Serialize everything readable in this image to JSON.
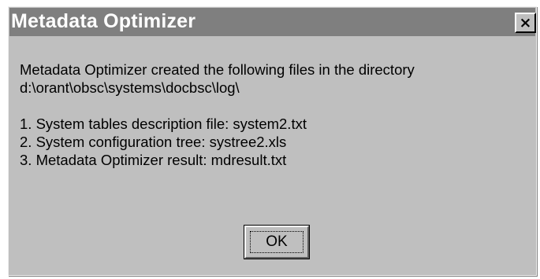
{
  "window": {
    "title": "Metadata Optimizer",
    "close_icon": "close-icon",
    "close_glyph": "×"
  },
  "message": {
    "intro_line1": "Metadata Optimizer created the following files in the directory",
    "intro_line2": "d:\\orant\\obsc\\systems\\docbsc\\log\\",
    "files": [
      "1. System tables description file: system2.txt",
      "2. System configuration tree: systree2.xls",
      "3. Metadata Optimizer result: mdresult.txt"
    ]
  },
  "buttons": {
    "ok_label": "OK"
  },
  "colors": {
    "dialog_face": "#bfbfbf",
    "titlebar": "#7f7f7f",
    "title_text": "#ffffff"
  }
}
